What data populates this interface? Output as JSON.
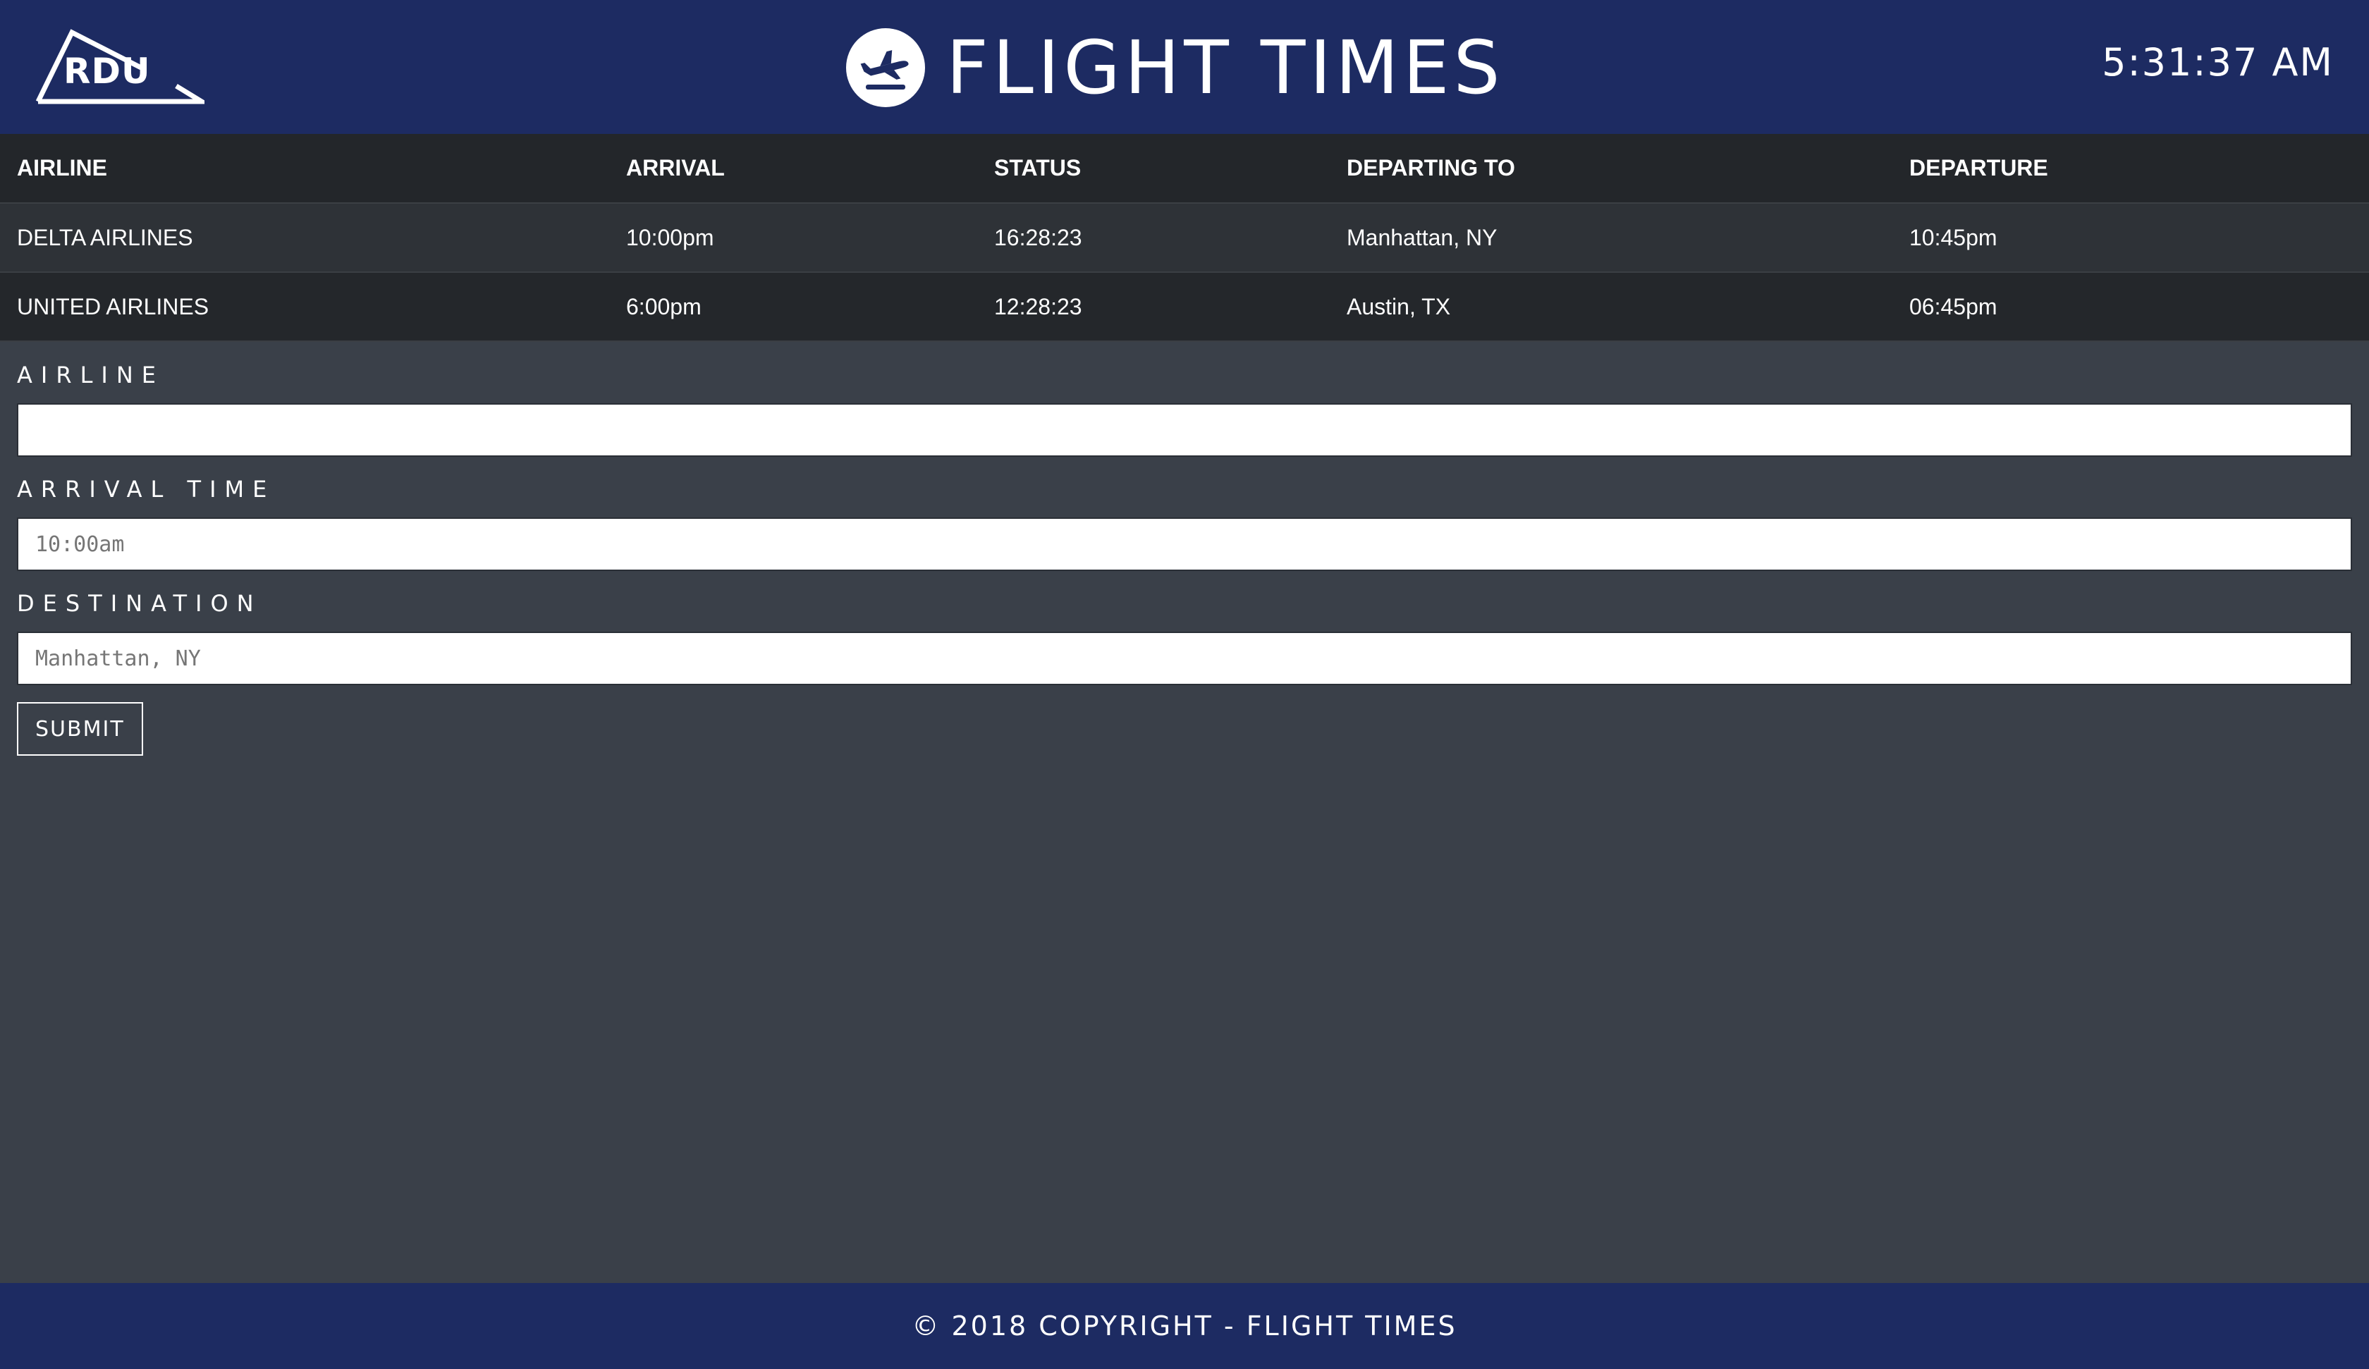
{
  "header": {
    "logo_text": "RDU",
    "title": "FLIGHT TIMES",
    "clock": "5:31:37 AM"
  },
  "table": {
    "columns": [
      "AIRLINE",
      "ARRIVAL",
      "STATUS",
      "DEPARTING TO",
      "DEPARTURE"
    ],
    "rows": [
      [
        "DELTA AIRLINES",
        "10:00pm",
        "16:28:23",
        "Manhattan, NY",
        "10:45pm"
      ],
      [
        "UNITED AIRLINES",
        "6:00pm",
        "12:28:23",
        "Austin, TX",
        "06:45pm"
      ]
    ]
  },
  "form": {
    "airline_label": "AIRLINE",
    "airline_placeholder": "",
    "arrival_label": "ARRIVAL TIME",
    "arrival_placeholder": "10:00am",
    "destination_label": "DESTINATION",
    "destination_placeholder": "Manhattan, NY",
    "submit_label": "SUBMIT"
  },
  "footer": {
    "text": "© 2018 COPYRIGHT - FLIGHT TIMES"
  },
  "colors": {
    "header_bg": "#1d2b62",
    "page_bg": "#3a4049",
    "table_header_bg": "#23262a",
    "row_odd_bg": "#2e3237",
    "row_even_bg": "#24272b"
  },
  "icons": {
    "logo": "rdu-logo-icon",
    "brand": "airplane-takeoff-icon"
  }
}
